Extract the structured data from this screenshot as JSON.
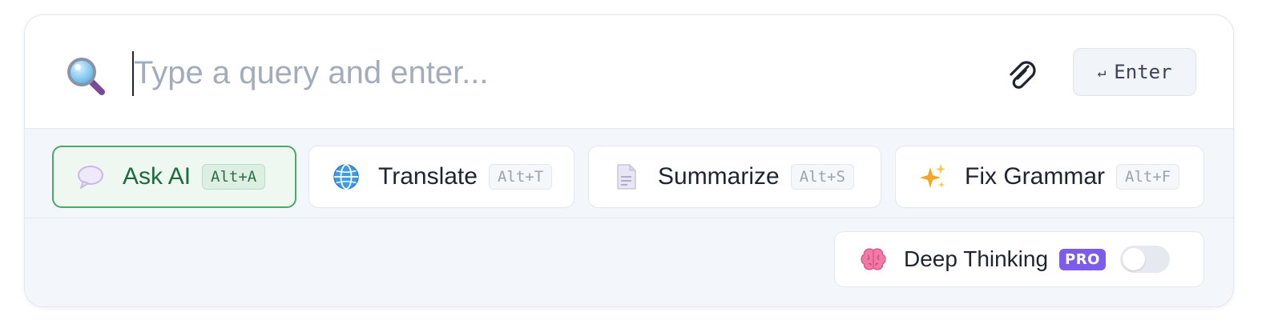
{
  "search": {
    "placeholder": "Type a query and enter...",
    "value": "",
    "icon": "magnifier-icon",
    "attach_icon": "paperclip-icon"
  },
  "enter_button": {
    "glyph": "↵",
    "label": "Enter"
  },
  "actions": [
    {
      "label": "Ask AI",
      "shortcut": "Alt+A",
      "icon": "speech-bubble-icon",
      "active": true
    },
    {
      "label": "Translate",
      "shortcut": "Alt+T",
      "icon": "globe-icon",
      "active": false
    },
    {
      "label": "Summarize",
      "shortcut": "Alt+S",
      "icon": "document-icon",
      "active": false
    },
    {
      "label": "Fix Grammar",
      "shortcut": "Alt+F",
      "icon": "sparkles-icon",
      "active": false
    }
  ],
  "deep_thinking": {
    "label": "Deep Thinking",
    "badge": "PRO",
    "icon": "brain-icon",
    "enabled": false
  },
  "colors": {
    "accent_green": "#49a86a",
    "pro_purple": "#7c5ce8",
    "placeholder_gray": "#a3acba"
  }
}
